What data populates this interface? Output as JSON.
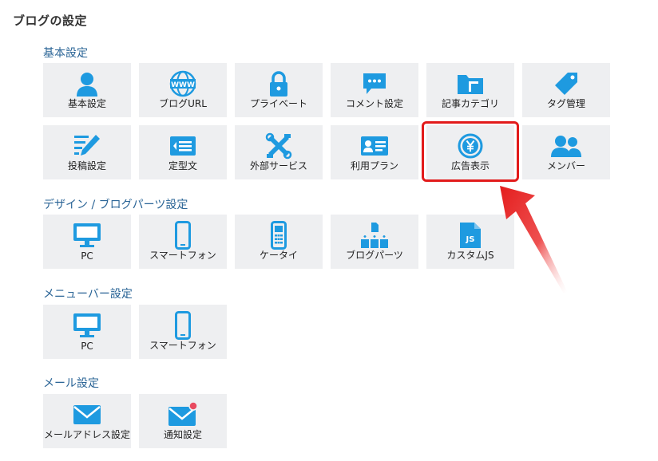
{
  "page_title": "ブログの設定",
  "sections": {
    "basic": {
      "title": "基本設定",
      "items": [
        "基本設定",
        "ブログURL",
        "プライベート",
        "コメント設定",
        "記事カテゴリ",
        "タグ管理",
        "投稿設定",
        "定型文",
        "外部サービス",
        "利用プラン",
        "広告表示",
        "メンバー"
      ],
      "icons": [
        "person-icon",
        "www-icon",
        "lock-icon",
        "comment-icon",
        "folder-icon",
        "tag-icon",
        "pencil-icon",
        "template-icon",
        "tools-icon",
        "id-card-icon",
        "yen-icon",
        "members-icon"
      ]
    },
    "design": {
      "title": "デザイン / ブログパーツ設定",
      "items": [
        "PC",
        "スマートフォン",
        "ケータイ",
        "ブログパーツ",
        "カスタムJS"
      ],
      "icons": [
        "monitor-icon",
        "smartphone-icon",
        "feature-phone-icon",
        "blocks-icon",
        "js-file-icon"
      ]
    },
    "menubar": {
      "title": "メニューバー設定",
      "items": [
        "PC",
        "スマートフォン"
      ],
      "icons": [
        "monitor-icon",
        "smartphone-icon"
      ]
    },
    "mail": {
      "title": "メール設定",
      "items": [
        "メールアドレス設定",
        "通知設定"
      ],
      "icons": [
        "mail-icon",
        "mail-notification-icon"
      ]
    }
  },
  "colors": {
    "icon": "#1e9ae0",
    "tile_bg": "#eeeff1",
    "highlight": "#e21b1b",
    "section_title": "#2a6496"
  }
}
